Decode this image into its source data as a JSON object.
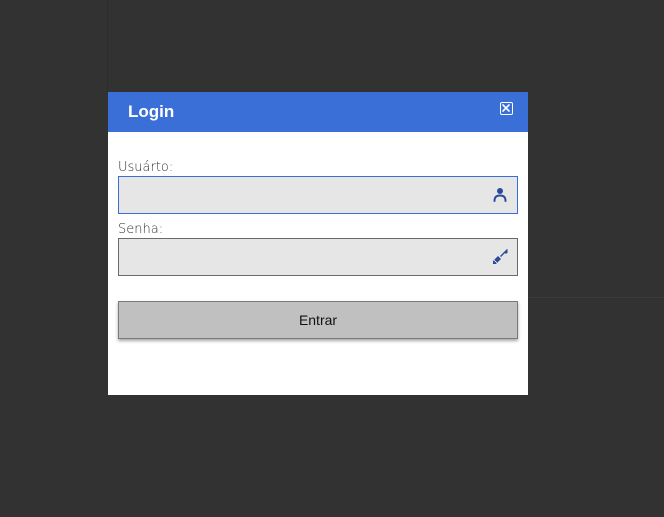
{
  "dialog": {
    "title": "Login",
    "close_icon": "close-icon",
    "accent_color": "#3a6fd8"
  },
  "form": {
    "username": {
      "label": "Usuárto:",
      "value": "",
      "icon": "user-icon"
    },
    "password": {
      "label": "Senha:",
      "value": "",
      "icon": "key-icon"
    },
    "submit_label": "Entrar"
  }
}
